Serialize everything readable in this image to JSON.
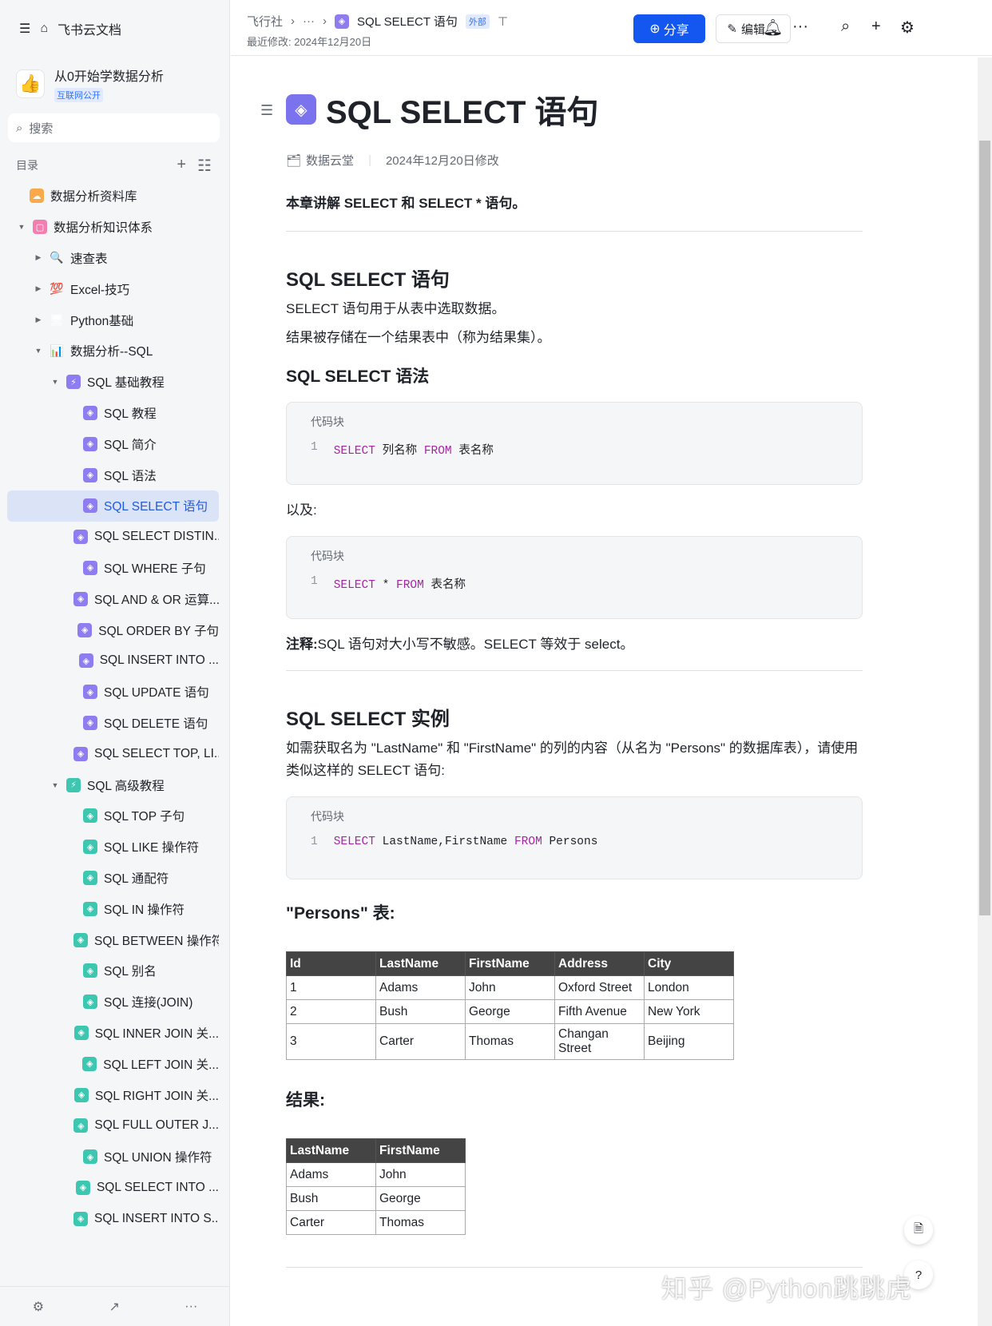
{
  "sidebar": {
    "app_title": "飞书云文档",
    "workspace_name": "从0开始学数据分析",
    "workspace_badge": "互联网公开",
    "search_placeholder": "搜索",
    "toc_label": "目录",
    "items": [
      {
        "label": "数据分析资料库",
        "level": 0,
        "arrow": "",
        "icon": "☁",
        "color": "#f8a94a"
      },
      {
        "label": "数据分析知识体系",
        "level": 0,
        "arrow": "▼",
        "icon": "▢",
        "color": "#f27fb0"
      },
      {
        "label": "速查表",
        "level": 1,
        "arrow": "▶",
        "icon": "🔍",
        "color": ""
      },
      {
        "label": "Excel-技巧",
        "level": 1,
        "arrow": "▶",
        "icon": "💯",
        "color": ""
      },
      {
        "label": "Python基础",
        "level": 1,
        "arrow": "▶",
        "icon": "🖥",
        "color": ""
      },
      {
        "label": "数据分析--SQL",
        "level": 1,
        "arrow": "▼",
        "icon": "📊",
        "color": ""
      },
      {
        "label": "SQL 基础教程",
        "level": 2,
        "arrow": "▼",
        "icon": "⚡",
        "color": "#8e7cf0"
      },
      {
        "label": "SQL 教程",
        "level": 3,
        "icon": "◈",
        "color": "#8e7cf0"
      },
      {
        "label": "SQL 简介",
        "level": 3,
        "icon": "◈",
        "color": "#8e7cf0"
      },
      {
        "label": "SQL 语法",
        "level": 3,
        "icon": "◈",
        "color": "#8e7cf0"
      },
      {
        "label": "SQL SELECT 语句",
        "level": 3,
        "icon": "◈",
        "color": "#8e7cf0",
        "active": true
      },
      {
        "label": "SQL SELECT DISTIN...",
        "level": 3,
        "icon": "◈",
        "color": "#8e7cf0"
      },
      {
        "label": "SQL WHERE 子句",
        "level": 3,
        "icon": "◈",
        "color": "#8e7cf0"
      },
      {
        "label": "SQL AND & OR 运算...",
        "level": 3,
        "icon": "◈",
        "color": "#8e7cf0"
      },
      {
        "label": "SQL ORDER BY 子句",
        "level": 3,
        "icon": "◈",
        "color": "#8e7cf0"
      },
      {
        "label": "SQL INSERT INTO ...",
        "level": 3,
        "icon": "◈",
        "color": "#8e7cf0"
      },
      {
        "label": "SQL UPDATE 语句",
        "level": 3,
        "icon": "◈",
        "color": "#8e7cf0"
      },
      {
        "label": "SQL DELETE 语句",
        "level": 3,
        "icon": "◈",
        "color": "#8e7cf0"
      },
      {
        "label": "SQL SELECT TOP, LI...",
        "level": 3,
        "icon": "◈",
        "color": "#8e7cf0"
      },
      {
        "label": "SQL 高级教程",
        "level": 2,
        "arrow": "▼",
        "icon": "⚡",
        "color": "#3ec7b0"
      },
      {
        "label": "SQL TOP 子句",
        "level": 3,
        "icon": "◈",
        "color": "#3ec7b0"
      },
      {
        "label": "SQL LIKE 操作符",
        "level": 3,
        "icon": "◈",
        "color": "#3ec7b0"
      },
      {
        "label": "SQL 通配符",
        "level": 3,
        "icon": "◈",
        "color": "#3ec7b0"
      },
      {
        "label": "SQL IN 操作符",
        "level": 3,
        "icon": "◈",
        "color": "#3ec7b0"
      },
      {
        "label": "SQL BETWEEN 操作符",
        "level": 3,
        "icon": "◈",
        "color": "#3ec7b0"
      },
      {
        "label": "SQL 别名",
        "level": 3,
        "icon": "◈",
        "color": "#3ec7b0"
      },
      {
        "label": "SQL 连接(JOIN)",
        "level": 3,
        "icon": "◈",
        "color": "#3ec7b0"
      },
      {
        "label": "SQL INNER JOIN 关...",
        "level": 3,
        "icon": "◈",
        "color": "#3ec7b0"
      },
      {
        "label": "SQL LEFT JOIN 关...",
        "level": 3,
        "icon": "◈",
        "color": "#3ec7b0"
      },
      {
        "label": "SQL RIGHT JOIN 关...",
        "level": 3,
        "icon": "◈",
        "color": "#3ec7b0"
      },
      {
        "label": "SQL FULL OUTER J...",
        "level": 3,
        "icon": "◈",
        "color": "#3ec7b0"
      },
      {
        "label": "SQL UNION 操作符",
        "level": 3,
        "icon": "◈",
        "color": "#3ec7b0"
      },
      {
        "label": "SQL SELECT INTO ...",
        "level": 3,
        "icon": "◈",
        "color": "#3ec7b0"
      },
      {
        "label": "SQL INSERT INTO S...",
        "level": 3,
        "icon": "◈",
        "color": "#3ec7b0"
      }
    ]
  },
  "topbar": {
    "crumb_root": "飞行社",
    "crumb_more": "···",
    "crumb_current": "SQL SELECT 语句",
    "external_badge": "外部",
    "last_modified": "最近修改: 2024年12月20日",
    "share_label": "分享",
    "edit_label": "编辑"
  },
  "doc": {
    "title": "SQL SELECT 语句",
    "author": "数据云堂",
    "modified": "2024年12月20日修改",
    "lead": "本章讲解 SELECT 和 SELECT * 语句。",
    "h_select": "SQL SELECT 语句",
    "p1": "SELECT 语句用于从表中选取数据。",
    "p2": "结果被存储在一个结果表中（称为结果集）。",
    "h_syntax": "SQL SELECT 语法",
    "code_label": "代码块",
    "line_no": "1",
    "code1": {
      "kw1": "SELECT",
      "t1": "列名称",
      "kw2": "FROM",
      "t2": "表名称"
    },
    "and_also": "以及:",
    "code2": {
      "kw1": "SELECT",
      "t1": "*",
      "kw2": "FROM",
      "t2": "表名称"
    },
    "note_bold": "注释:",
    "note": "SQL 语句对大小写不敏感。SELECT 等效于 select。",
    "h_example": "SQL SELECT 实例",
    "example_text": "如需获取名为 \"LastName\" 和 \"FirstName\" 的列的内容（从名为 \"Persons\" 的数据库表），请使用类似这样的 SELECT 语句:",
    "code3": {
      "kw1": "SELECT",
      "t1": "LastName,FirstName",
      "kw2": "FROM",
      "t2": "Persons"
    },
    "persons_heading": "\"Persons\" 表:",
    "persons": {
      "headers": [
        "Id",
        "LastName",
        "FirstName",
        "Address",
        "City"
      ],
      "rows": [
        [
          "1",
          "Adams",
          "John",
          "Oxford Street",
          "London"
        ],
        [
          "2",
          "Bush",
          "George",
          "Fifth Avenue",
          "New York"
        ],
        [
          "3",
          "Carter",
          "Thomas",
          "Changan Street",
          "Beijing"
        ]
      ]
    },
    "result_heading": "结果:",
    "result": {
      "headers": [
        "LastName",
        "FirstName"
      ],
      "rows": [
        [
          "Adams",
          "John"
        ],
        [
          "Bush",
          "George"
        ],
        [
          "Carter",
          "Thomas"
        ]
      ]
    }
  },
  "watermark": "知乎 @Python跳跳虎"
}
